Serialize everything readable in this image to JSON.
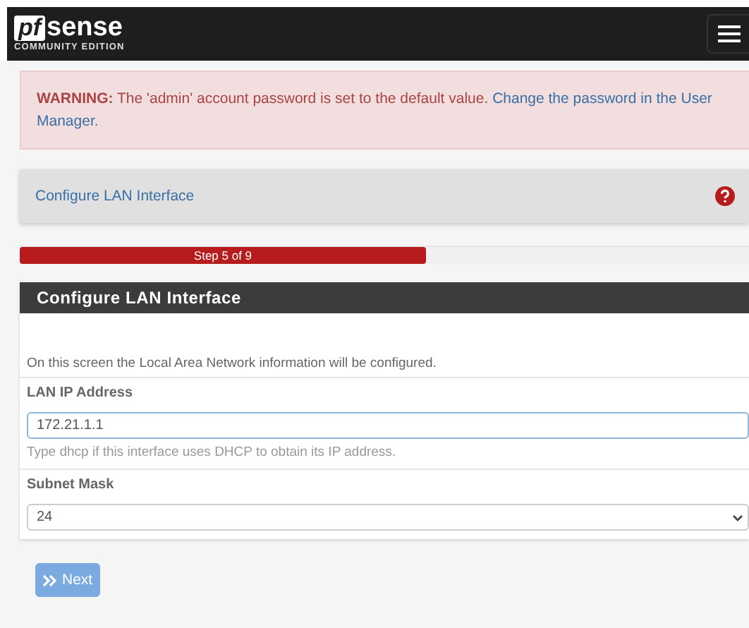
{
  "navbar": {
    "logo_mark": "pf",
    "logo_word": "sense",
    "edition": "COMMUNITY EDITION"
  },
  "alert": {
    "text": "**WARNING:** The 'admin' account password is set to the default value.",
    "link_lines": [
      "Change the password in the User",
      "Manager."
    ]
  },
  "breadcrumb": {
    "title": "Configure LAN Interface"
  },
  "progress": {
    "label": "Step 5 of 9",
    "level": 0.557
  },
  "panel": {
    "title": "Configure LAN Interface",
    "intro": "On this screen the Local Area Network information will be configured.",
    "fields": [
      {
        "kind": "input",
        "label": "LAN IP Address",
        "value": "172.21.1.1",
        "focused": true,
        "help": "Type dhcp if this interface uses DHCP to obtain its IP address."
      },
      {
        "kind": "select",
        "label": "Subnet Mask",
        "value": "24",
        "focused": false
      }
    ]
  },
  "next_button": {
    "label": "Next"
  }
}
